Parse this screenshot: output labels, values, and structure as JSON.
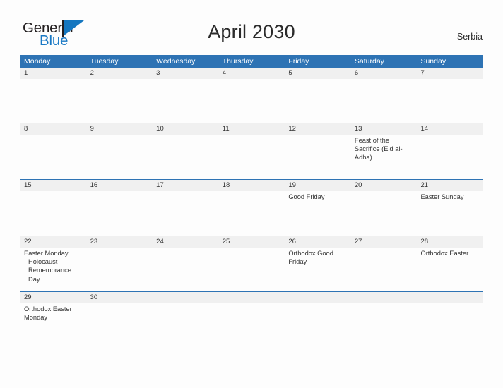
{
  "brand": {
    "word_one": "General",
    "word_two": "Blue",
    "accent_color": "#1577c0"
  },
  "header": {
    "title": "April 2030",
    "country": "Serbia"
  },
  "calendar": {
    "header_color": "#2e73b4",
    "daynumber_band_color": "#f0f0f0",
    "weekdays": [
      "Monday",
      "Tuesday",
      "Wednesday",
      "Thursday",
      "Friday",
      "Saturday",
      "Sunday"
    ],
    "weeks": [
      {
        "numbers": [
          "1",
          "2",
          "3",
          "4",
          "5",
          "6",
          "7"
        ],
        "events": [
          [],
          [],
          [],
          [],
          [],
          [],
          []
        ]
      },
      {
        "numbers": [
          "8",
          "9",
          "10",
          "11",
          "12",
          "13",
          "14"
        ],
        "events": [
          [],
          [],
          [],
          [],
          [],
          [
            "Feast of the Sacrifice (Eid al-Adha)"
          ],
          []
        ]
      },
      {
        "numbers": [
          "15",
          "16",
          "17",
          "18",
          "19",
          "20",
          "21"
        ],
        "events": [
          [],
          [],
          [],
          [],
          [
            "Good Friday"
          ],
          [],
          [
            "Easter Sunday"
          ]
        ]
      },
      {
        "numbers": [
          "22",
          "23",
          "24",
          "25",
          "26",
          "27",
          "28"
        ],
        "events": [
          [
            "Easter Monday",
            "Holocaust Remembrance Day"
          ],
          [],
          [],
          [],
          [
            "Orthodox Good Friday"
          ],
          [],
          [
            "Orthodox Easter"
          ]
        ]
      },
      {
        "numbers": [
          "29",
          "30",
          "",
          "",
          "",
          "",
          ""
        ],
        "events": [
          [
            "Orthodox Easter Monday"
          ],
          [],
          [],
          [],
          [],
          [],
          []
        ]
      }
    ]
  }
}
